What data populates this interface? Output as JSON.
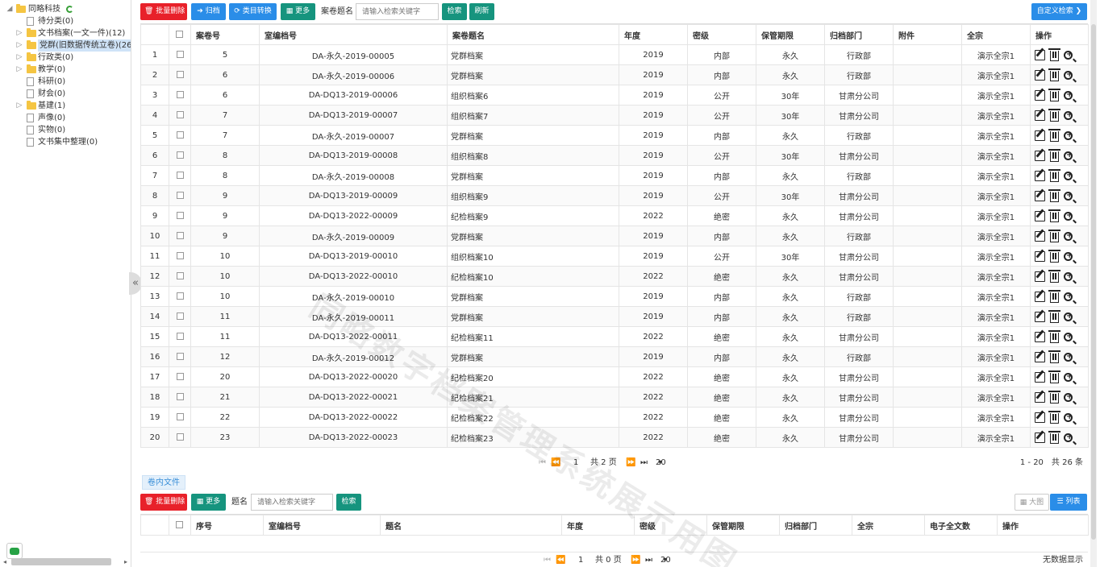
{
  "tree": [
    {
      "label": "同略科技",
      "arrow": "◢",
      "icon": "folder",
      "indent": 0,
      "extra": "refresh"
    },
    {
      "label": "待分类(0)",
      "arrow": "",
      "icon": "doc",
      "indent": 1
    },
    {
      "label": "文书档案(一文一件)(12)",
      "arrow": "▷",
      "icon": "folder",
      "indent": 1
    },
    {
      "label": "党群(旧数据传统立卷)(26",
      "arrow": "▷",
      "icon": "folder",
      "indent": 1,
      "selected": true
    },
    {
      "label": "行政类(0)",
      "arrow": "▷",
      "icon": "folder",
      "indent": 1
    },
    {
      "label": "教学(0)",
      "arrow": "▷",
      "icon": "folder",
      "indent": 1
    },
    {
      "label": "科研(0)",
      "arrow": "",
      "icon": "doc",
      "indent": 1
    },
    {
      "label": "财会(0)",
      "arrow": "",
      "icon": "doc",
      "indent": 1
    },
    {
      "label": "基建(1)",
      "arrow": "▷",
      "icon": "folder",
      "indent": 1
    },
    {
      "label": "声像(0)",
      "arrow": "",
      "icon": "doc",
      "indent": 1
    },
    {
      "label": "实物(0)",
      "arrow": "",
      "icon": "doc",
      "indent": 1
    },
    {
      "label": "文书集中整理(0)",
      "arrow": "",
      "icon": "doc",
      "indent": 1
    }
  ],
  "toolbar": {
    "batch_delete": "批量删除",
    "archive": "归档",
    "category_convert": "类目转换",
    "more": "更多",
    "search_label": "案卷题名",
    "search_placeholder": "请输入检索关键字",
    "search_btn": "检索",
    "refresh_btn": "刷新",
    "custom_search": "自定义检索"
  },
  "table": {
    "columns": [
      "",
      "",
      "案卷号",
      "室编档号",
      "案卷题名",
      "年度",
      "密级",
      "保管期限",
      "归档部门",
      "附件",
      "全宗",
      "操作"
    ],
    "rows": [
      [
        "1",
        "5",
        "DA-永久-2019-00005",
        "党群档案",
        "2019",
        "内部",
        "永久",
        "行政部",
        "",
        "演示全宗1"
      ],
      [
        "2",
        "6",
        "DA-永久-2019-00006",
        "党群档案",
        "2019",
        "内部",
        "永久",
        "行政部",
        "",
        "演示全宗1"
      ],
      [
        "3",
        "6",
        "DA-DQ13-2019-00006",
        "组织档案6",
        "2019",
        "公开",
        "30年",
        "甘肃分公司",
        "",
        "演示全宗1"
      ],
      [
        "4",
        "7",
        "DA-DQ13-2019-00007",
        "组织档案7",
        "2019",
        "公开",
        "30年",
        "甘肃分公司",
        "",
        "演示全宗1"
      ],
      [
        "5",
        "7",
        "DA-永久-2019-00007",
        "党群档案",
        "2019",
        "内部",
        "永久",
        "行政部",
        "",
        "演示全宗1"
      ],
      [
        "6",
        "8",
        "DA-DQ13-2019-00008",
        "组织档案8",
        "2019",
        "公开",
        "30年",
        "甘肃分公司",
        "",
        "演示全宗1"
      ],
      [
        "7",
        "8",
        "DA-永久-2019-00008",
        "党群档案",
        "2019",
        "内部",
        "永久",
        "行政部",
        "",
        "演示全宗1"
      ],
      [
        "8",
        "9",
        "DA-DQ13-2019-00009",
        "组织档案9",
        "2019",
        "公开",
        "30年",
        "甘肃分公司",
        "",
        "演示全宗1"
      ],
      [
        "9",
        "9",
        "DA-DQ13-2022-00009",
        "纪检档案9",
        "2022",
        "绝密",
        "永久",
        "甘肃分公司",
        "",
        "演示全宗1"
      ],
      [
        "10",
        "9",
        "DA-永久-2019-00009",
        "党群档案",
        "2019",
        "内部",
        "永久",
        "行政部",
        "",
        "演示全宗1"
      ],
      [
        "11",
        "10",
        "DA-DQ13-2019-00010",
        "组织档案10",
        "2019",
        "公开",
        "30年",
        "甘肃分公司",
        "",
        "演示全宗1"
      ],
      [
        "12",
        "10",
        "DA-DQ13-2022-00010",
        "纪检档案10",
        "2022",
        "绝密",
        "永久",
        "甘肃分公司",
        "",
        "演示全宗1"
      ],
      [
        "13",
        "10",
        "DA-永久-2019-00010",
        "党群档案",
        "2019",
        "内部",
        "永久",
        "行政部",
        "",
        "演示全宗1"
      ],
      [
        "14",
        "11",
        "DA-永久-2019-00011",
        "党群档案",
        "2019",
        "内部",
        "永久",
        "行政部",
        "",
        "演示全宗1"
      ],
      [
        "15",
        "11",
        "DA-DQ13-2022-00011",
        "纪检档案11",
        "2022",
        "绝密",
        "永久",
        "甘肃分公司",
        "",
        "演示全宗1"
      ],
      [
        "16",
        "12",
        "DA-永久-2019-00012",
        "党群档案",
        "2019",
        "内部",
        "永久",
        "行政部",
        "",
        "演示全宗1"
      ],
      [
        "17",
        "20",
        "DA-DQ13-2022-00020",
        "纪检档案20",
        "2022",
        "绝密",
        "永久",
        "甘肃分公司",
        "",
        "演示全宗1"
      ],
      [
        "18",
        "21",
        "DA-DQ13-2022-00021",
        "纪检档案21",
        "2022",
        "绝密",
        "永久",
        "甘肃分公司",
        "",
        "演示全宗1"
      ],
      [
        "19",
        "22",
        "DA-DQ13-2022-00022",
        "纪检档案22",
        "2022",
        "绝密",
        "永久",
        "甘肃分公司",
        "",
        "演示全宗1"
      ],
      [
        "20",
        "23",
        "DA-DQ13-2022-00023",
        "纪检档案23",
        "2022",
        "绝密",
        "永久",
        "甘肃分公司",
        "",
        "演示全宗1"
      ]
    ]
  },
  "pager": {
    "page": "1",
    "total_pages": "共 2 页",
    "page_size": "20",
    "summary": "1 - 20　共 26 条"
  },
  "files_tab": "卷内文件",
  "toolbar2": {
    "batch_delete": "批量删除",
    "more": "更多",
    "search_label": "题名",
    "search_placeholder": "请输入检索关键字",
    "search_btn": "检索",
    "big_icon": "大图",
    "list": "列表"
  },
  "table2": {
    "columns": [
      "",
      "",
      "序号",
      "室编档号",
      "题名",
      "年度",
      "密级",
      "保管期限",
      "归档部门",
      "全宗",
      "电子全文数",
      "操作"
    ]
  },
  "pager2": {
    "page": "1",
    "total_pages": "共 0 页",
    "page_size": "20",
    "summary": "无数据显示"
  },
  "watermark": "同略数字档案管理系统展示用图",
  "colors": {
    "red": "#e8212a",
    "blue": "#2a8de8",
    "teal": "#16947e"
  }
}
